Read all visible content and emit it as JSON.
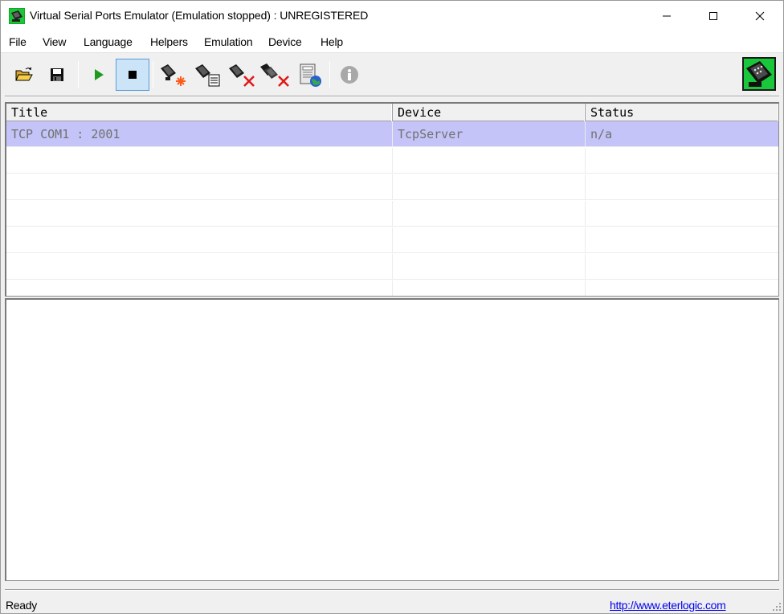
{
  "window": {
    "title": "Virtual Serial Ports Emulator (Emulation stopped) : UNREGISTERED",
    "controls": {
      "minimize": "minimize-icon",
      "maximize": "maximize-icon",
      "close": "close-icon"
    }
  },
  "menu": {
    "items": [
      {
        "label": "File"
      },
      {
        "label": "View"
      },
      {
        "label": "Language"
      },
      {
        "label": "Helpers"
      },
      {
        "label": "Emulation"
      },
      {
        "label": "Device"
      },
      {
        "label": "Help"
      }
    ]
  },
  "toolbar": {
    "buttons": [
      {
        "icon": "open-folder-icon"
      },
      {
        "icon": "save-floppy-icon"
      },
      {
        "icon": "play-icon"
      },
      {
        "icon": "stop-icon",
        "pressed": true
      },
      {
        "icon": "new-device-icon"
      },
      {
        "icon": "edit-device-icon"
      },
      {
        "icon": "delete-device-icon"
      },
      {
        "icon": "delete-all-devices-icon"
      },
      {
        "icon": "network-settings-icon"
      },
      {
        "icon": "info-icon"
      }
    ],
    "logo": "serial-port-logo-icon"
  },
  "device_list": {
    "headers": [
      "Title",
      "Device",
      "Status"
    ],
    "rows": [
      {
        "title": "TCP COM1 : 2001",
        "device": "TcpServer",
        "status": "n/a",
        "selected": true
      }
    ]
  },
  "log": {
    "lines": []
  },
  "statusbar": {
    "text": "Ready",
    "link": "http://www.eterlogic.com"
  },
  "colors": {
    "selected_row": "#c4c4f8",
    "play_green": "#1e9a1e",
    "link": "#0000ee",
    "pressed_button": "#cce4f7"
  }
}
